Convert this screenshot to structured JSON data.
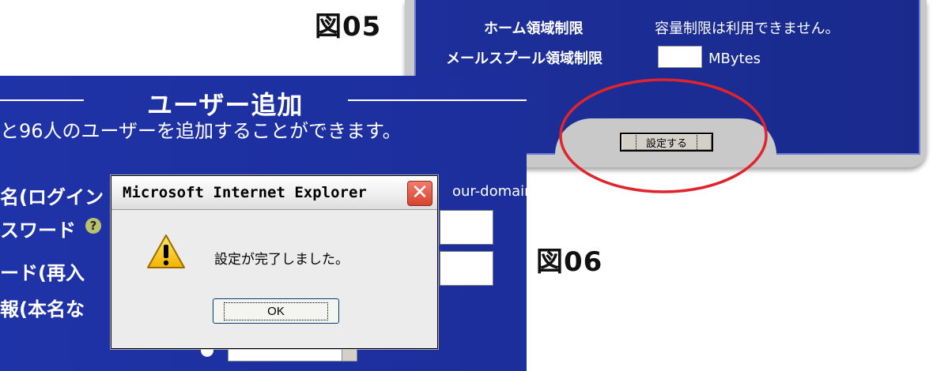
{
  "figures": {
    "fig05_label": "図05",
    "fig06_label": "図06"
  },
  "panel05": {
    "home_label": "ホーム領域制限",
    "home_value": "容量制限は利用できません。",
    "mail_label": "メールスプール領域制限",
    "mail_input_value": "",
    "mail_unit": "MBytes",
    "set_button_label": "設定する",
    "accent_color": "#1d2f9a"
  },
  "panel06": {
    "title": "ユーザー追加",
    "info": "と96人のユーザーを追加することができます。",
    "username_label": "名(ログイン",
    "password_label": "スワード",
    "password_help_icon": "?",
    "password2_label": "ード(再入",
    "info_label": "報(本名な",
    "domain_text": "our-domain",
    "select_value": "",
    "accent_color": "#1f33a8"
  },
  "dialog": {
    "title": "Microsoft Internet Explorer",
    "close_glyph": "✕",
    "message": "設定が完了しました。",
    "ok_label": "OK",
    "icon": "warning-icon"
  },
  "annotation": {
    "circle_color": "#e0242b"
  }
}
